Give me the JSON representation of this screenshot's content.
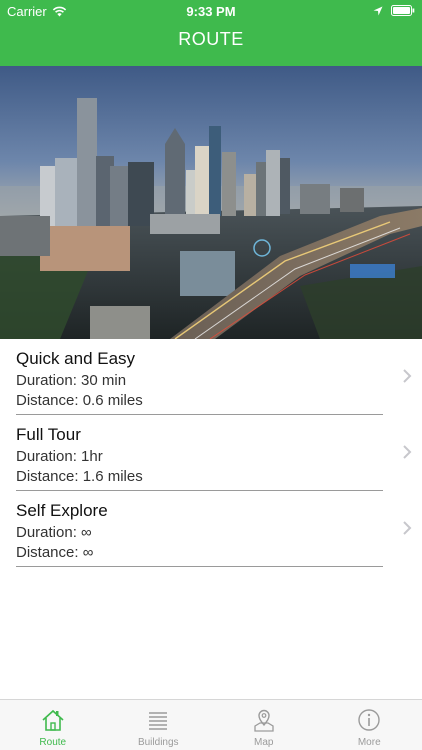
{
  "status_bar": {
    "carrier": "Carrier",
    "time": "9:33 PM"
  },
  "nav": {
    "title": "ROUTE"
  },
  "hero": {
    "icon": "city-skyline-photo"
  },
  "routes": [
    {
      "title": "Quick and Easy",
      "duration": "Duration: 30 min",
      "distance": "Distance: 0.6 miles"
    },
    {
      "title": "Full Tour",
      "duration": "Duration: 1hr",
      "distance": "Distance: 1.6 miles"
    },
    {
      "title": "Self Explore",
      "duration": "Duration: ∞",
      "distance": "Distance: ∞"
    }
  ],
  "tabs": [
    {
      "label": "Route",
      "icon": "home-icon",
      "active": true
    },
    {
      "label": "Buildings",
      "icon": "list-icon",
      "active": false
    },
    {
      "label": "Map",
      "icon": "map-pin-icon",
      "active": false
    },
    {
      "label": "More",
      "icon": "info-icon",
      "active": false
    }
  ],
  "colors": {
    "accent": "#3fba4d",
    "tab_inactive": "#9b9b9b",
    "divider": "#9a9a9a"
  }
}
